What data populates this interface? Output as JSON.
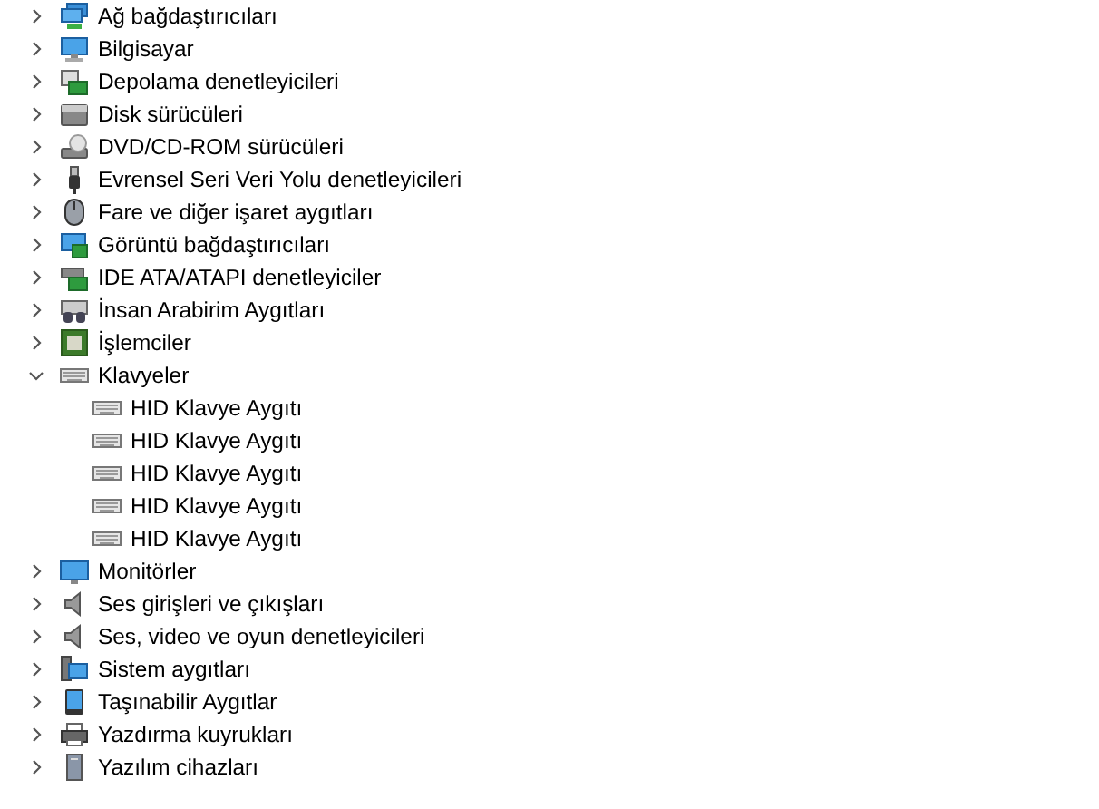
{
  "tree": [
    {
      "label": "Ağ bağdaştırıcıları",
      "kind": "network",
      "expanded": false
    },
    {
      "label": "Bilgisayar",
      "kind": "computer",
      "expanded": false
    },
    {
      "label": "Depolama denetleyicileri",
      "kind": "storage",
      "expanded": false
    },
    {
      "label": "Disk sürücüleri",
      "kind": "disk",
      "expanded": false
    },
    {
      "label": "DVD/CD-ROM sürücüleri",
      "kind": "dvd",
      "expanded": false
    },
    {
      "label": "Evrensel Seri Veri Yolu denetleyicileri",
      "kind": "usb",
      "expanded": false
    },
    {
      "label": "Fare ve diğer işaret aygıtları",
      "kind": "mouse",
      "expanded": false
    },
    {
      "label": "Görüntü bağdaştırıcıları",
      "kind": "display",
      "expanded": false
    },
    {
      "label": "IDE ATA/ATAPI denetleyiciler",
      "kind": "ide",
      "expanded": false
    },
    {
      "label": "İnsan Arabirim Aygıtları",
      "kind": "hid",
      "expanded": false
    },
    {
      "label": "İşlemciler",
      "kind": "cpu",
      "expanded": false
    },
    {
      "label": "Klavyeler",
      "kind": "keyboard",
      "expanded": true,
      "children": [
        {
          "label": "HID Klavye Aygıtı",
          "kind": "keyboard"
        },
        {
          "label": "HID Klavye Aygıtı",
          "kind": "keyboard"
        },
        {
          "label": "HID Klavye Aygıtı",
          "kind": "keyboard"
        },
        {
          "label": "HID Klavye Aygıtı",
          "kind": "keyboard"
        },
        {
          "label": "HID Klavye Aygıtı",
          "kind": "keyboard"
        }
      ]
    },
    {
      "label": "Monitörler",
      "kind": "monitor",
      "expanded": false
    },
    {
      "label": "Ses girişleri ve çıkışları",
      "kind": "speaker",
      "expanded": false
    },
    {
      "label": "Ses, video ve oyun denetleyicileri",
      "kind": "speaker",
      "expanded": false
    },
    {
      "label": "Sistem aygıtları",
      "kind": "system",
      "expanded": false
    },
    {
      "label": "Taşınabilir Aygıtlar",
      "kind": "portable",
      "expanded": false
    },
    {
      "label": "Yazdırma kuyrukları",
      "kind": "printer",
      "expanded": false
    },
    {
      "label": "Yazılım cihazları",
      "kind": "software",
      "expanded": false
    }
  ]
}
